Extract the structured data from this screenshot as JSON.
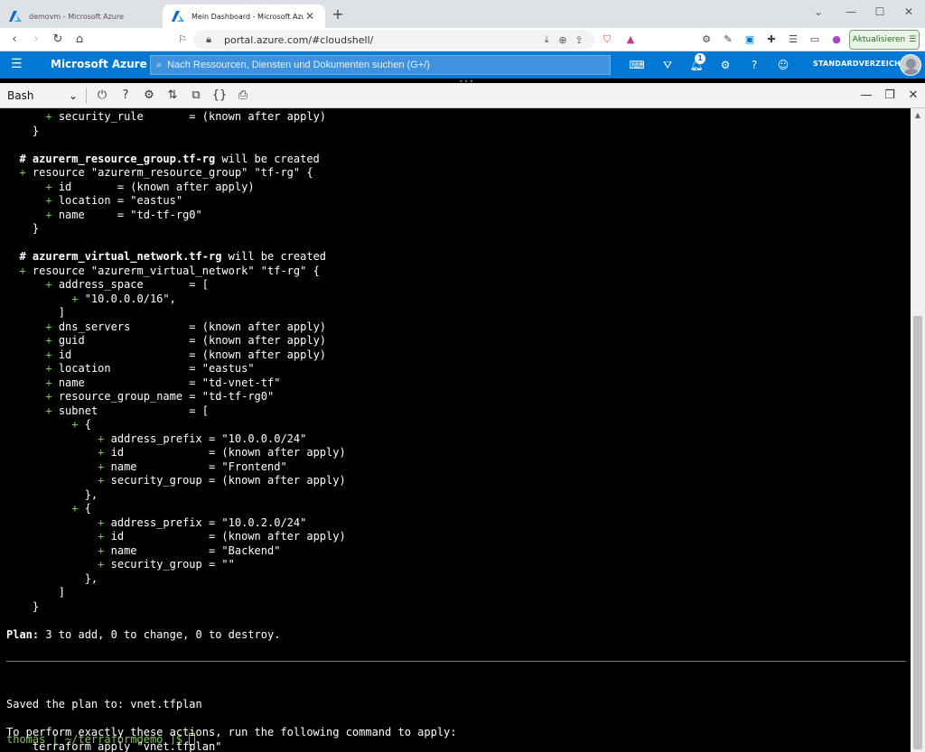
{
  "browser": {
    "tabs": [
      {
        "title": "demovm - Microsoft Azure",
        "active": false
      },
      {
        "title": "Mein Dashboard - Microsoft Azure",
        "active": true
      }
    ],
    "url": "portal.azure.com/#cloudshell/",
    "update_label": "Aktualisieren"
  },
  "azure": {
    "brand": "Microsoft Azure",
    "search_placeholder": "Nach Ressourcen, Diensten und Dokumenten suchen (G+/)",
    "notification_count": "1",
    "directory": "STANDARDVERZEICHNIS"
  },
  "shell": {
    "selected": "Bash"
  },
  "terminal": {
    "lines": [
      "      + security_rule       = (known after apply)",
      "    }",
      "",
      "  # azurerm_resource_group.tf-rg will be created",
      "  + resource \"azurerm_resource_group\" \"tf-rg\" {",
      "      + id       = (known after apply)",
      "      + location = \"eastus\"",
      "      + name     = \"td-tf-rg0\"",
      "    }",
      "",
      "  # azurerm_virtual_network.tf-rg will be created",
      "  + resource \"azurerm_virtual_network\" \"tf-rg\" {",
      "      + address_space       = [",
      "          + \"10.0.0.0/16\",",
      "        ]",
      "      + dns_servers         = (known after apply)",
      "      + guid                = (known after apply)",
      "      + id                  = (known after apply)",
      "      + location            = \"eastus\"",
      "      + name                = \"td-vnet-tf\"",
      "      + resource_group_name = \"td-tf-rg0\"",
      "      + subnet              = [",
      "          + {",
      "              + address_prefix = \"10.0.0.0/24\"",
      "              + id             = (known after apply)",
      "              + name           = \"Frontend\"",
      "              + security_group = (known after apply)",
      "            },",
      "          + {",
      "              + address_prefix = \"10.0.2.0/24\"",
      "              + id             = (known after apply)",
      "              + name           = \"Backend\"",
      "              + security_group = \"\"",
      "            },",
      "        ]",
      "    }",
      "",
      "Plan: 3 to add, 0 to change, 0 to destroy.",
      "",
      "",
      "",
      "",
      "Saved the plan to: vnet.tfplan",
      "",
      "To perform exactly these actions, run the following command to apply:",
      "    terraform apply \"vnet.tfplan\""
    ],
    "prompt_user": "thomas",
    "prompt_path": " [ ~/terraformdemo ]$ "
  }
}
